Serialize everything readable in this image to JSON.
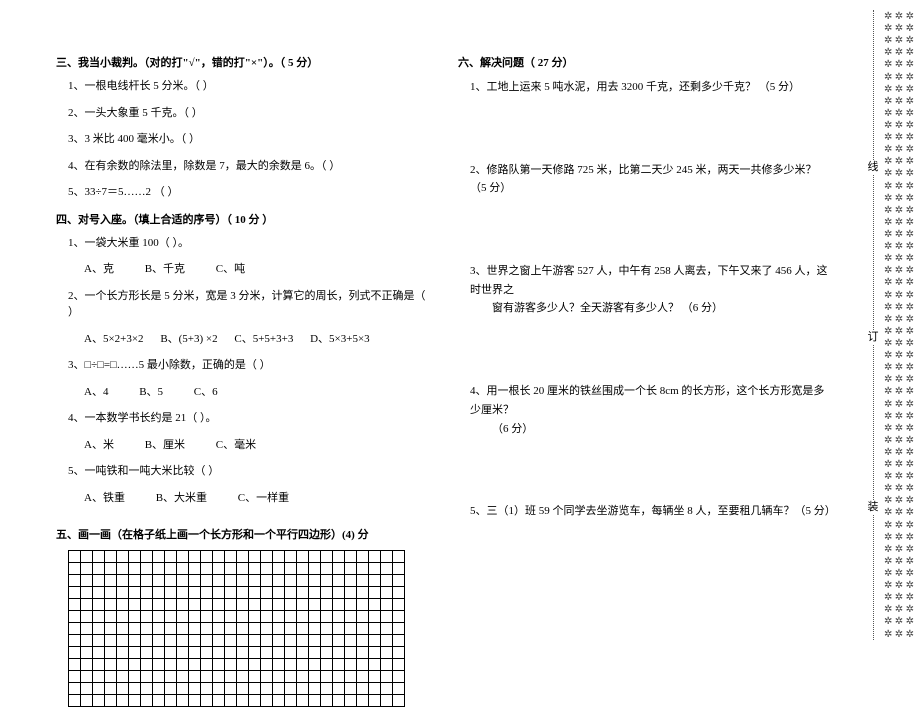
{
  "section3": {
    "heading": "三、我当小裁判。（对的打\"√\"，错的打\"×\"）。（ 5 分）",
    "items": [
      "1、一根电线杆长 5 分米。（        ）",
      "2、一头大象重 5 千克。（        ）",
      "3、3 米比 400 毫米小。（        ）",
      "4、在有余数的除法里，除数是 7，最大的余数是 6。（        ）",
      "5、33÷7＝5……2 （        ）"
    ]
  },
  "section4": {
    "heading": "四、对号入座。（填上合适的序号）（ 10 分 ）",
    "q1": {
      "text": "1、一袋大米重 100（        ）。",
      "opts": {
        "a": "A、克",
        "b": "B、千克",
        "c": "C、吨"
      }
    },
    "q2": {
      "text": "2、一个长方形长是 5 分米，宽是 3 分米，计算它的周长，列式不正确是（        ）",
      "opts": {
        "a": "A、5×2+3×2",
        "b": "B、(5+3) ×2",
        "c": "C、5+5+3+3",
        "d": "D、5×3+5×3"
      }
    },
    "q3": {
      "text": "3、□÷□=□……5 最小除数，正确的是（        ）",
      "opts": {
        "a": "A、4",
        "b": "B、5",
        "c": "C、6"
      }
    },
    "q4": {
      "text": "4、一本数学书长约是 21（      ）。",
      "opts": {
        "a": "A、米",
        "b": "B、厘米",
        "c": "C、毫米"
      }
    },
    "q5": {
      "text": "5、一吨铁和一吨大米比较（        ）",
      "opts": {
        "a": "A、铁重",
        "b": "B、大米重",
        "c": "C、一样重"
      }
    }
  },
  "section5": {
    "heading": "五、画一画（在格子纸上画一个长方形和一个平行四边形）(4) 分",
    "grid_rows": 13,
    "grid_cols": 28
  },
  "section6": {
    "heading": "六、解决问题（ 27 分）",
    "q1": "1、工地上运来 5 吨水泥，用去 3200 千克，还剩多少千克？ （5 分）",
    "q2": "2、修路队第一天修路 725 米，比第二天少 245 米，两天一共修多少米？ （5 分）",
    "q3": {
      "l1": "3、世界之窗上午游客 527 人，中午有 258 人离去，下午又来了 456 人，这时世界之",
      "l2": "窗有游客多少人？全天游客有多少人？ （6 分）"
    },
    "q4": {
      "l1": "4、用一根长 20 厘米的铁丝围成一个长 8cm 的长方形，这个长方形宽是多少厘米？",
      "l2": "（6 分）"
    },
    "q5": "5、三（1）班 59 个同学去坐游览车，每辆坐 8 人，至要租几辆车？（5 分）"
  },
  "binding": {
    "c1": "线",
    "c2": "订",
    "c3": "装"
  }
}
